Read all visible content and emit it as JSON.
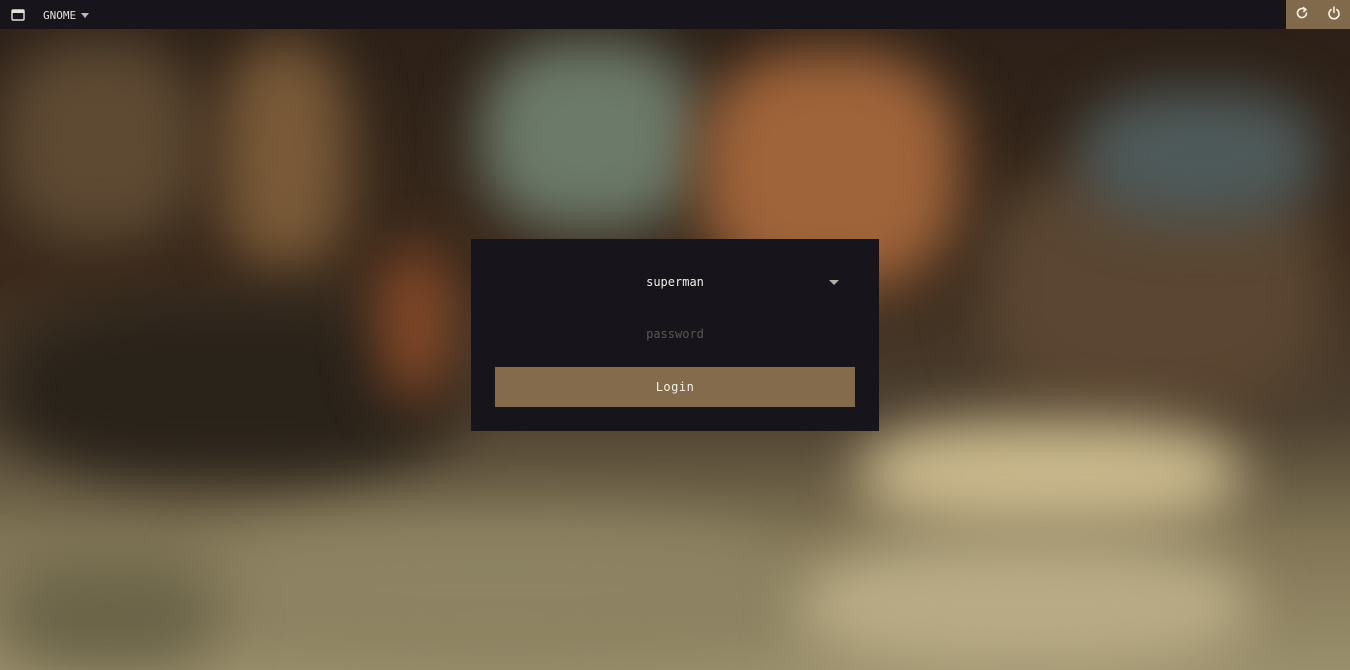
{
  "topbar": {
    "session_name": "GNOME",
    "session_icon": "window-icon",
    "restart_icon": "restart-icon",
    "power_icon": "power-icon"
  },
  "login": {
    "username": "superman",
    "password_placeholder": "password",
    "login_label": "Login"
  },
  "colors": {
    "panel": "#17151b",
    "accent": "#836b4b",
    "power_area": "#816a4b",
    "text": "#f0ece6",
    "placeholder": "#5a5650"
  }
}
